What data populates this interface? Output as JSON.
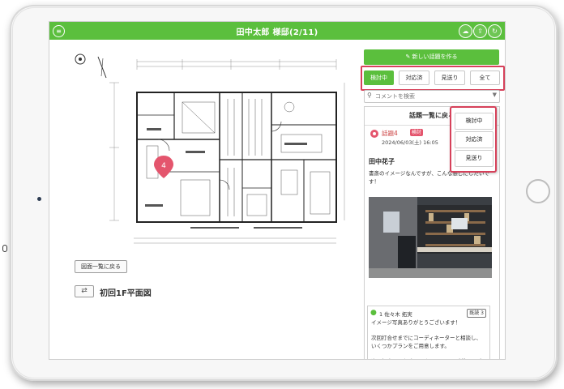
{
  "app": {
    "title": "田中太郎 様邸(2/11)",
    "accent_color": "#5bbf3d",
    "highlight_color": "#d6415a"
  },
  "toolbar": {
    "menu_icon": "menu-icon",
    "icons": [
      "cloud-icon",
      "cloud-upload-icon",
      "refresh-icon"
    ]
  },
  "drawing": {
    "pin_number": "4",
    "back_label": "図面一覧に戻る",
    "swap_icon": "swap-icon",
    "title": "初回1F平面図"
  },
  "sidebar": {
    "new_topic_label": "新しい話題を作る",
    "filters": [
      {
        "label": "検討中",
        "active": true
      },
      {
        "label": "対応済",
        "active": false
      },
      {
        "label": "見送り",
        "active": false
      },
      {
        "label": "全て",
        "active": false
      }
    ],
    "search_placeholder": "コメントを検索",
    "list_header": "話題一覧に戻る",
    "topic": {
      "number": "話題4",
      "status_badge": "検討",
      "date": "2024/06/03(土) 16:05",
      "author": "田中花子",
      "message": "書斎のイメージなんですが、こんな感じにしたいです！"
    },
    "reply": {
      "author": "1 佐々木 拓実",
      "read": "既読 3",
      "text": "イメージ写真ありがとうございます！\n\n次回打合せまでにコーディネーターと相談し、いくつかプランをご用意します。\n\n次回打合せにお時間頂きますので、ご質問・ご要望等ありましたら、お気軽にご連絡ください！"
    },
    "status_menu": [
      "検討中",
      "対応済",
      "見送り"
    ]
  }
}
